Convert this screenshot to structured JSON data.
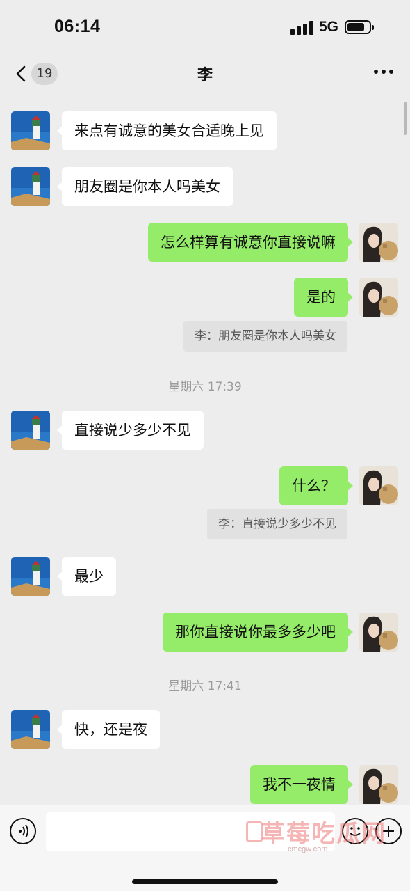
{
  "status_bar": {
    "time": "06:14",
    "network": "5G",
    "icons": [
      "signal-icon",
      "battery-icon"
    ]
  },
  "header": {
    "back_icon": "chevron-left-icon",
    "unread_count": "19",
    "title": "李",
    "more_icon": "more-dots-icon"
  },
  "messages": [
    {
      "side": "in",
      "text": "来点有诚意的美女合适晚上见"
    },
    {
      "side": "in",
      "text": "朋友圈是你本人吗美女"
    },
    {
      "side": "out",
      "text": "怎么样算有诚意你直接说嘛"
    },
    {
      "side": "out",
      "text": "是的"
    },
    {
      "side": "out",
      "text": "什么？"
    },
    {
      "side": "in",
      "text": "直接说少多少不见"
    },
    {
      "side": "in",
      "text": "最少"
    },
    {
      "side": "out",
      "text": "那你直接说你最多多少吧"
    },
    {
      "side": "in",
      "text": "快，还是夜"
    },
    {
      "side": "out",
      "text": "我不一夜情"
    }
  ],
  "quotes": [
    {
      "text": "李：朋友圈是你本人吗美女"
    },
    {
      "text": "李：直接说少多少不见"
    }
  ],
  "timestamps": [
    "星期六 17:39",
    "星期六 17:41"
  ],
  "input_bar": {
    "icons": [
      "voice-icon",
      "emoji-icon",
      "plus-icon"
    ],
    "input_value": ""
  },
  "watermark": {
    "text": "草莓吃瓜网",
    "url": "cmcgw.com"
  },
  "colors": {
    "background": "#ededed",
    "incoming_bubble": "#ffffff",
    "outgoing_bubble": "#95ec69",
    "quote_bg": "#e1e1e1"
  }
}
